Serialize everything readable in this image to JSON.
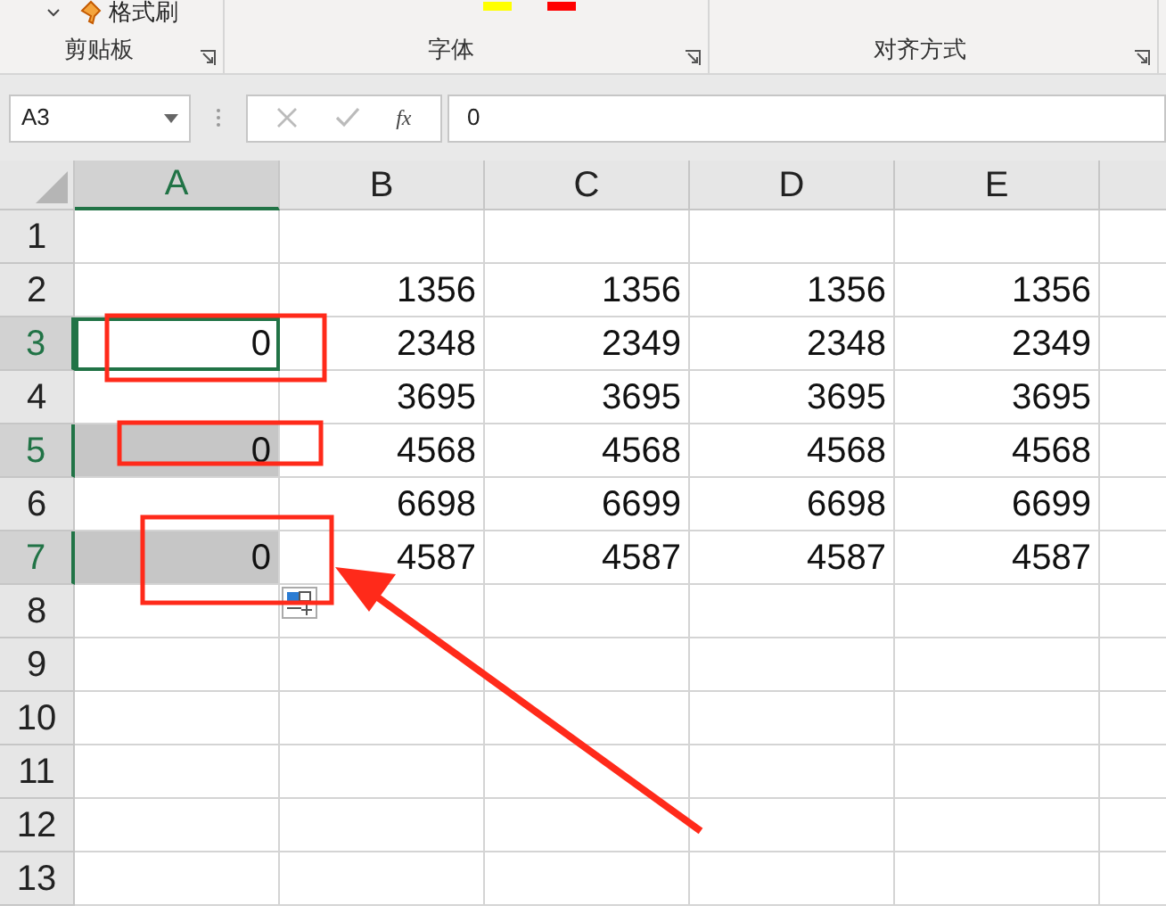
{
  "ribbon": {
    "format_painter": "格式刷",
    "groups": [
      {
        "label": "剪贴板"
      },
      {
        "label": "字体"
      },
      {
        "label": "对齐方式"
      }
    ]
  },
  "formula_bar": {
    "name_box": "A3",
    "function_label": "fx",
    "value": "0"
  },
  "columns": [
    {
      "label": "A",
      "selected": true
    },
    {
      "label": "B",
      "selected": false
    },
    {
      "label": "C",
      "selected": false
    },
    {
      "label": "D",
      "selected": false
    },
    {
      "label": "E",
      "selected": false
    }
  ],
  "rows": [
    {
      "label": "1",
      "selected": false,
      "active": false,
      "cells": [
        null,
        null,
        null,
        null,
        null
      ]
    },
    {
      "label": "2",
      "selected": false,
      "active": false,
      "cells": [
        null,
        "1356",
        "1356",
        "1356",
        "1356"
      ]
    },
    {
      "label": "3",
      "selected": true,
      "active": true,
      "cells": [
        "0",
        "2348",
        "2349",
        "2348",
        "2349"
      ]
    },
    {
      "label": "4",
      "selected": false,
      "active": false,
      "cells": [
        null,
        "3695",
        "3695",
        "3695",
        "3695"
      ]
    },
    {
      "label": "5",
      "selected": true,
      "active": false,
      "cells": [
        "0",
        "4568",
        "4568",
        "4568",
        "4568"
      ]
    },
    {
      "label": "6",
      "selected": false,
      "active": false,
      "cells": [
        null,
        "6698",
        "6699",
        "6698",
        "6699"
      ]
    },
    {
      "label": "7",
      "selected": true,
      "active": false,
      "cells": [
        "0",
        "4587",
        "4587",
        "4587",
        "4587"
      ]
    },
    {
      "label": "8",
      "selected": false,
      "active": false,
      "cells": [
        null,
        null,
        null,
        null,
        null
      ]
    },
    {
      "label": "9",
      "selected": false,
      "active": false,
      "cells": [
        null,
        null,
        null,
        null,
        null
      ]
    },
    {
      "label": "10",
      "selected": false,
      "active": false,
      "cells": [
        null,
        null,
        null,
        null,
        null
      ]
    },
    {
      "label": "11",
      "selected": false,
      "active": false,
      "cells": [
        null,
        null,
        null,
        null,
        null
      ]
    },
    {
      "label": "12",
      "selected": false,
      "active": false,
      "cells": [
        null,
        null,
        null,
        null,
        null
      ]
    },
    {
      "label": "13",
      "selected": false,
      "active": false,
      "cells": [
        null,
        null,
        null,
        null,
        null
      ]
    }
  ]
}
